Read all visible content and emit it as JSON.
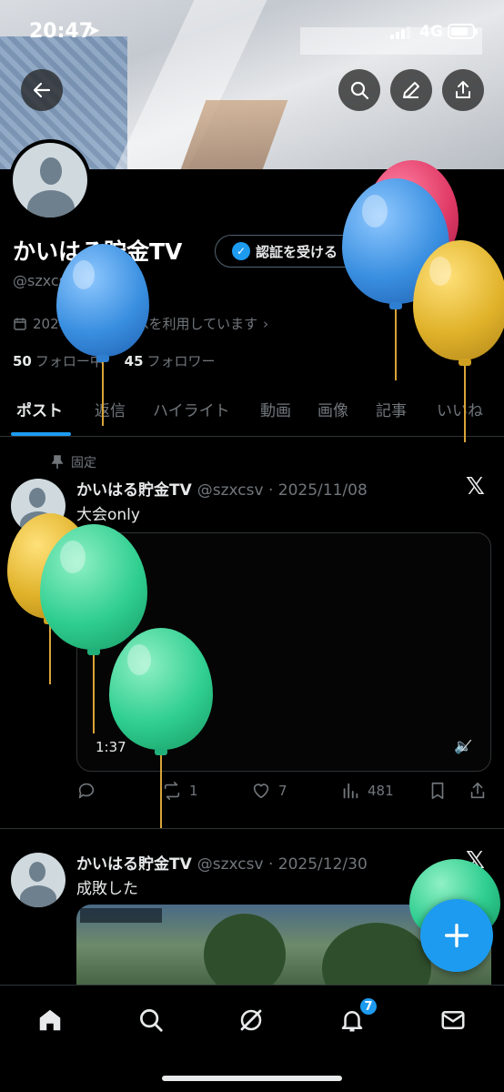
{
  "status_bar": {
    "time": "20:47",
    "network": "4G"
  },
  "colors": {
    "accent": "#1d9bf0",
    "balloon_blue": "#3a8fe0",
    "balloon_yellow": "#e0b22a",
    "balloon_green": "#2fce90",
    "balloon_red": "#e03a66"
  },
  "header": {
    "back_icon": "arrow-left-icon",
    "search_icon": "search-icon",
    "edit_icon": "pencil-icon",
    "share_icon": "share-icon"
  },
  "profile": {
    "name": "かいはる貯金TV",
    "verify_button": "認証を受ける",
    "handle": "@szxcsv",
    "joined": "2024年12月からXを利用しています",
    "following_count": "50",
    "following_label": "フォロー中",
    "followers_count": "45",
    "followers_label": "フォロワー"
  },
  "tabs": [
    "ポスト",
    "返信",
    "ハイライト",
    "動画",
    "画像",
    "記事",
    "いいね"
  ],
  "posts": [
    {
      "pinned_label": "固定",
      "author": "かいはる貯金TV",
      "handle_date": "@szxcsv · 2025/11/08",
      "text": "大会only",
      "video_duration": "1:37",
      "replies": "",
      "reposts": "1",
      "likes": "7",
      "views": "481"
    },
    {
      "author": "かいはる貯金TV",
      "handle_date": "@szxcsv · 2025/12/30",
      "text": "成敗した"
    }
  ],
  "bottom_nav": {
    "items": [
      "home-icon",
      "search-icon",
      "grok-icon",
      "bell-icon",
      "mail-icon"
    ],
    "notification_count": "7"
  }
}
